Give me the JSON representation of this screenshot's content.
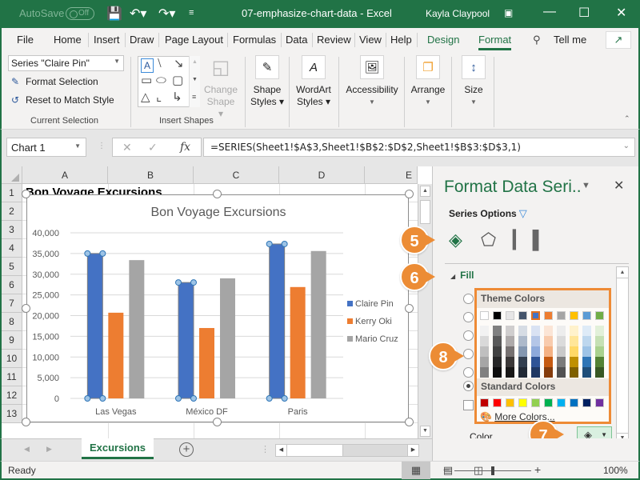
{
  "titlebar": {
    "autosave_label": "AutoSave",
    "autosave_state": "Off",
    "doc_title": "07-emphasize-chart-data  -  Excel",
    "user": "Kayla Claypool",
    "icons": [
      "save-icon",
      "undo-icon",
      "redo-icon",
      "customize-qat-icon",
      "ribbon-display-icon",
      "minimize-icon",
      "maximize-icon",
      "close-icon"
    ]
  },
  "ribbon_tabs": {
    "items": [
      "File",
      "Home",
      "Insert",
      "Draw",
      "Page Layout",
      "Formulas",
      "Data",
      "Review",
      "View",
      "Help",
      "Design",
      "Format"
    ],
    "active": "Format",
    "tell_me": "Tell me"
  },
  "ribbon": {
    "current_selection": {
      "dropdown_value": "Series \"Claire Pin\"",
      "format_selection": "Format Selection",
      "reset_to_match_style": "Reset to Match Style",
      "group_label": "Current Selection"
    },
    "insert_shapes": {
      "change_shape_line1": "Change",
      "change_shape_line2": "Shape",
      "group_label": "Insert Shapes"
    },
    "buttons": [
      {
        "line1": "Shape",
        "line2": "Styles",
        "icon": "shape-styles-icon"
      },
      {
        "line1": "WordArt",
        "line2": "Styles",
        "icon": "wordart-styles-icon"
      },
      {
        "line1": "Accessibility",
        "line2": "",
        "icon": "alt-text-icon"
      },
      {
        "line1": "Arrange",
        "line2": "",
        "icon": "arrange-icon"
      },
      {
        "line1": "Size",
        "line2": "",
        "icon": "size-icon"
      }
    ]
  },
  "formula_bar": {
    "name_box": "Chart 1",
    "formula": "=SERIES(Sheet1!$A$3,Sheet1!$B$2:$D$2,Sheet1!$B$3:$D$3,1)",
    "fx": "fx"
  },
  "sheet": {
    "columns": [
      "A",
      "B",
      "C",
      "D",
      "E"
    ],
    "rows": [
      "1",
      "2",
      "3",
      "4",
      "5",
      "6",
      "7",
      "8",
      "9",
      "10",
      "11",
      "12",
      "13"
    ],
    "a1": "Bon Voyage Excursions"
  },
  "chart_data": {
    "type": "bar",
    "title": "Bon Voyage Excursions",
    "categories": [
      "Las Vegas",
      "México DF",
      "Paris"
    ],
    "series": [
      {
        "name": "Claire Pin",
        "color": "#4472c4",
        "values": [
          35000,
          28000,
          37300
        ],
        "selected": true
      },
      {
        "name": "Kerry Oki",
        "color": "#ed7d31",
        "values": [
          20700,
          17000,
          26900
        ]
      },
      {
        "name": "Mario Cruz",
        "color": "#a5a5a5",
        "values": [
          33400,
          29000,
          35600
        ]
      }
    ],
    "yticks": [
      "0",
      "5,000",
      "10,000",
      "15,000",
      "20,000",
      "25,000",
      "30,000",
      "35,000",
      "40,000"
    ],
    "ylim": [
      0,
      40000
    ],
    "xlabel": "",
    "ylabel": "",
    "grid": true,
    "legend": "right"
  },
  "pane": {
    "title": "Format Data Seri..",
    "series_options": "Series Options",
    "section": "Fill",
    "color_label": "Color",
    "current_color": "#4472c4"
  },
  "palette": {
    "theme_label": "Theme Colors",
    "standard_label": "Standard Colors",
    "more_colors": "More Colors...",
    "theme_top": [
      "#ffffff",
      "#000000",
      "#e7e6e6",
      "#44546a",
      "#4472c4",
      "#ed7d31",
      "#a5a5a5",
      "#ffc000",
      "#5b9bd5",
      "#70ad47"
    ],
    "theme_selected_index": 4,
    "theme_tints": [
      [
        "#f2f2f2",
        "#d9d9d9",
        "#bfbfbf",
        "#a6a6a6",
        "#808080"
      ],
      [
        "#808080",
        "#595959",
        "#404040",
        "#262626",
        "#0d0d0d"
      ],
      [
        "#d0cece",
        "#aeaaaa",
        "#767171",
        "#3b3838",
        "#181717"
      ],
      [
        "#d6dce4",
        "#adb9ca",
        "#8497b0",
        "#333f4f",
        "#222a35"
      ],
      [
        "#d9e2f3",
        "#b4c6e7",
        "#8eaadb",
        "#2f5496",
        "#1f3864"
      ],
      [
        "#fbe5d6",
        "#f8cbad",
        "#f4b183",
        "#c55a11",
        "#843c0c"
      ],
      [
        "#ededed",
        "#dbdbdb",
        "#c9c9c9",
        "#7b7b7b",
        "#525252"
      ],
      [
        "#fff2cc",
        "#ffe699",
        "#ffd966",
        "#bf9000",
        "#7f6000"
      ],
      [
        "#deebf7",
        "#bdd7ee",
        "#9dc3e6",
        "#2e75b6",
        "#1f4e79"
      ],
      [
        "#e2f0d9",
        "#c5e0b4",
        "#a9d18e",
        "#548235",
        "#385723"
      ]
    ],
    "standard": [
      "#c00000",
      "#ff0000",
      "#ffc000",
      "#ffff00",
      "#92d050",
      "#00b050",
      "#00b0f0",
      "#0070c0",
      "#002060",
      "#7030a0"
    ]
  },
  "callouts": [
    "5",
    "6",
    "7",
    "8"
  ],
  "sheet_tabs": {
    "active": "Excursions"
  },
  "status": {
    "ready": "Ready",
    "zoom": "100%"
  }
}
